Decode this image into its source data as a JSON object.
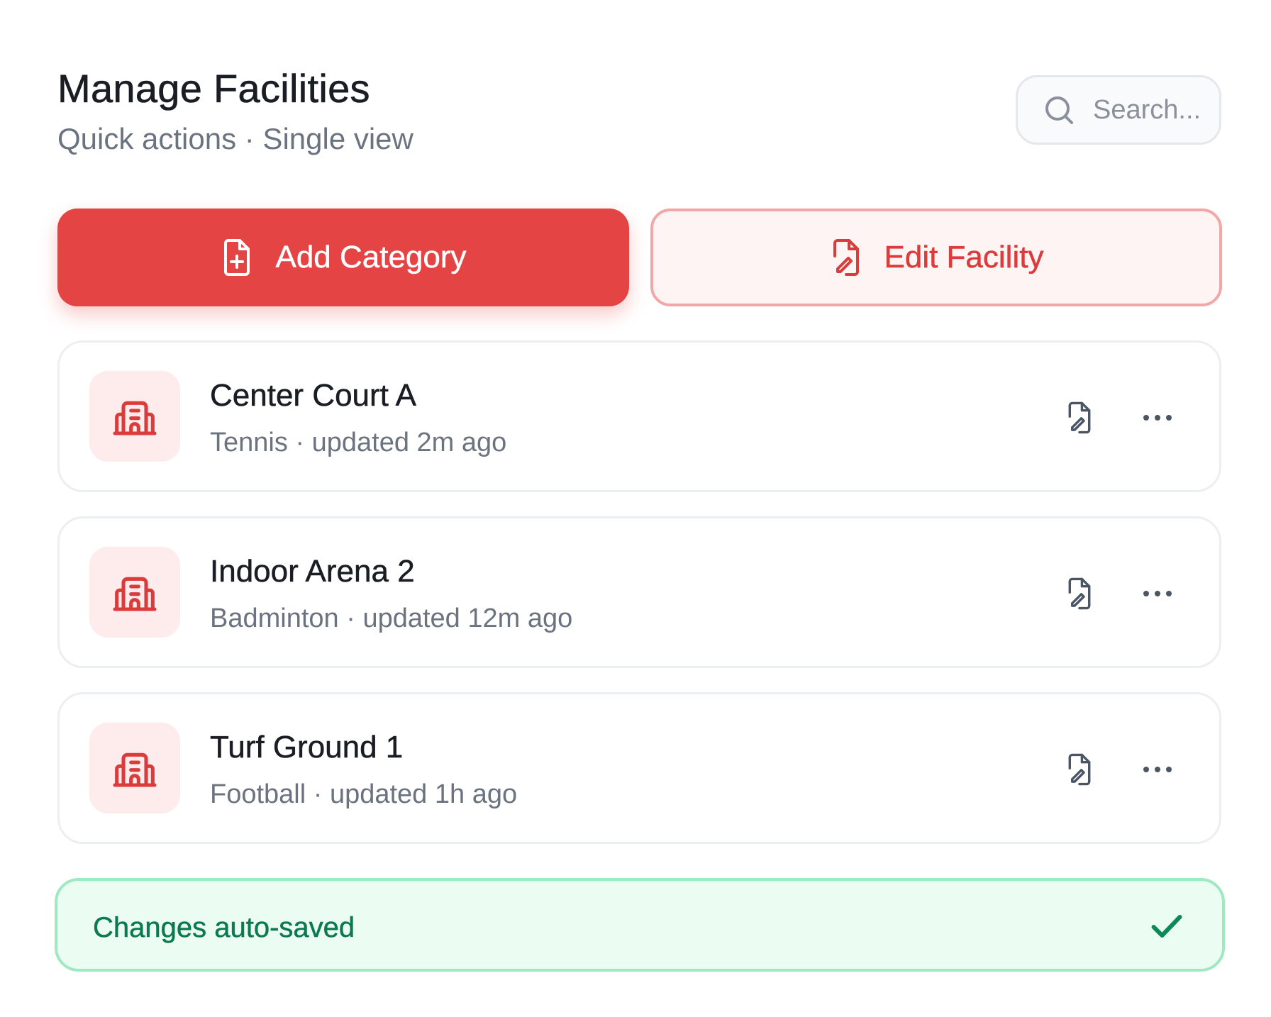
{
  "header": {
    "title": "Manage Facilities",
    "subtitle": "Quick actions · Single view"
  },
  "search": {
    "placeholder": "Search...",
    "icon": "search-icon"
  },
  "actions": {
    "primary": {
      "label": "Add Category",
      "icon": "file-plus-icon"
    },
    "secondary": {
      "label": "Edit Facility",
      "icon": "file-edit-icon"
    }
  },
  "facilities": [
    {
      "name": "Center Court A",
      "meta": "Tennis · updated 2m ago",
      "icon": "building-icon"
    },
    {
      "name": "Indoor Arena 2",
      "meta": "Badminton · updated 12m ago",
      "icon": "building-icon"
    },
    {
      "name": "Turf Ground 1",
      "meta": "Football · updated 1h ago",
      "icon": "building-icon"
    }
  ],
  "status": {
    "text": "Changes auto-saved",
    "icon": "check-icon"
  },
  "colors": {
    "accent": "#e54444",
    "accent_soft": "#fff4f4",
    "success": "#0b7a4e",
    "success_bg": "#ebfcf3"
  }
}
